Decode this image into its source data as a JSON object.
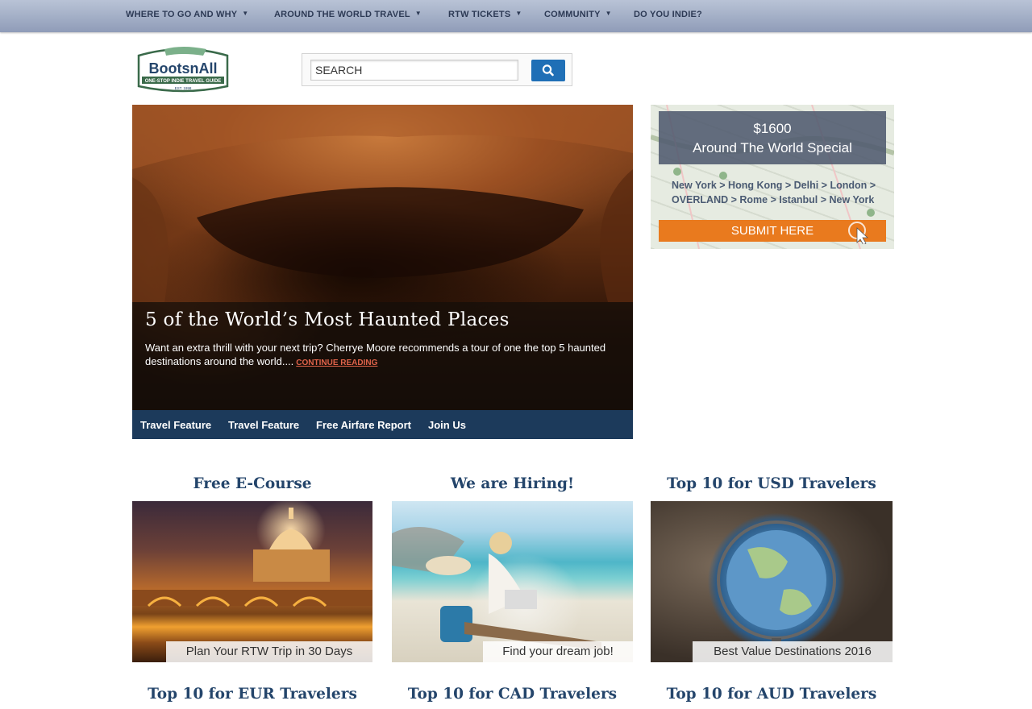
{
  "top_nav": {
    "items": [
      {
        "label": "WHERE TO GO AND WHY",
        "has_dropdown": true
      },
      {
        "label": "AROUND THE WORLD TRAVEL",
        "has_dropdown": true
      },
      {
        "label": "RTW TICKETS",
        "has_dropdown": true
      },
      {
        "label": "COMMUNITY",
        "has_dropdown": true
      },
      {
        "label": "DO YOU INDIE?",
        "has_dropdown": false
      }
    ],
    "caret": "▼"
  },
  "logo": {
    "name": "BootsnAll",
    "tagline": "ONE-STOP INDIE TRAVEL GUIDE",
    "est": "EST. 1998"
  },
  "search": {
    "placeholder": "SEARCH",
    "button_icon": "search-icon"
  },
  "hero": {
    "title": "5 of the World’s Most Haunted Places",
    "text": "Want an extra thrill with your next trip? Cherrye Moore recommends a tour of one the top 5 haunted destinations around the world....",
    "link": "CONTINUE READING",
    "tabs": [
      "Travel Feature",
      "Travel Feature",
      "Free Airfare Report",
      "Join Us"
    ]
  },
  "ad": {
    "price": "$1600",
    "special": "Around The World Special",
    "route_line1": "New York > Hong Kong > Delhi > London >",
    "route_line2": "OVERLAND > Rome > Istanbul > New York",
    "cta": "SUBMIT HERE"
  },
  "cards_row1": [
    {
      "title": "Free E-Course",
      "caption": "Plan Your RTW Trip in 30 Days"
    },
    {
      "title": "We are Hiring!",
      "caption": "Find your dream job!"
    },
    {
      "title": "Top 10 for USD Travelers",
      "caption": "Best Value Destinations 2016"
    }
  ],
  "cards_row2": [
    {
      "title": "Top 10 for EUR Travelers"
    },
    {
      "title": "Top 10 for CAD Travelers"
    },
    {
      "title": "Top 10 for AUD Travelers"
    }
  ],
  "colors": {
    "nav_text": "#2d3a55",
    "hero_tab_bar": "#1c3a5b",
    "card_title": "#24456b",
    "link_accent": "#e0634a",
    "search_button": "#1f6fb6",
    "ad_cta": "#e97a1e"
  }
}
